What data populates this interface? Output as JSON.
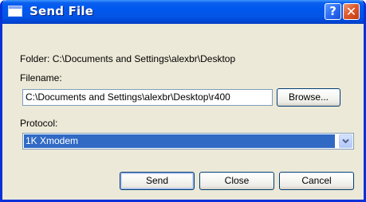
{
  "window": {
    "title": "Send File",
    "help_glyph": "?",
    "close_glyph": "✕",
    "titlebar_color": "#0058EE",
    "face_color": "#ECE9D8"
  },
  "folder": {
    "label": "Folder:",
    "path": "C:\\Documents and Settings\\alexbr\\Desktop"
  },
  "filename": {
    "label": "Filename:",
    "value": "C:\\Documents and Settings\\alexbr\\Desktop\\r400",
    "browse_label": "Browse..."
  },
  "protocol": {
    "label": "Protocol:",
    "selected": "1K Xmodem",
    "selection_color": "#316AC5"
  },
  "buttons": {
    "send": "Send",
    "close": "Close",
    "cancel": "Cancel"
  },
  "icons": {
    "window_icon": "window-icon",
    "help": "help-icon",
    "close": "close-icon",
    "dropdown": "chevron-down-icon"
  }
}
